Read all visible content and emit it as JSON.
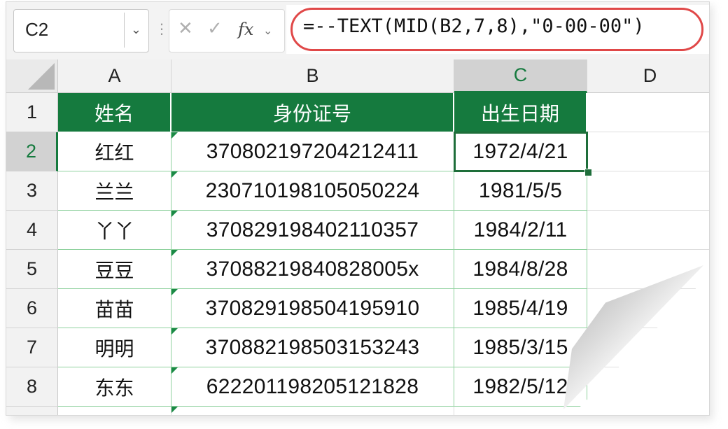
{
  "name_box": {
    "value": "C2"
  },
  "formula_bar": {
    "formula": "=--TEXT(MID(B2,7,8),\"0-00-00\")",
    "cancel_icon": "close-icon",
    "enter_icon": "check-icon",
    "fx_label": "fx"
  },
  "columns": [
    "A",
    "B",
    "C",
    "D"
  ],
  "selected_column": "C",
  "rows": [
    "1",
    "2",
    "3",
    "4",
    "5",
    "6",
    "7",
    "8"
  ],
  "selected_row": "2",
  "table": {
    "headers": [
      "姓名",
      "身份证号",
      "出生日期"
    ],
    "data": [
      [
        "红红",
        "370802197204212411",
        "1972/4/21"
      ],
      [
        "兰兰",
        "230710198105050224",
        "1981/5/5"
      ],
      [
        "丫丫",
        "370829198402110357",
        "1984/2/11"
      ],
      [
        "豆豆",
        "37088219840828005x",
        "1984/8/28"
      ],
      [
        "苗苗",
        "370829198504195910",
        "1985/4/19"
      ],
      [
        "明明",
        "370882198503153243",
        "1985/3/15"
      ],
      [
        "东东",
        "622201198205121828",
        "1982/5/12"
      ]
    ]
  },
  "colors": {
    "header_green": "#157a3e",
    "grid_green": "#8fd19e",
    "highlight_red": "#e04848"
  }
}
